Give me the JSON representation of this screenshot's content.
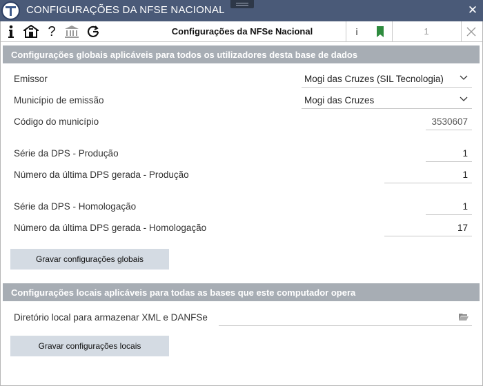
{
  "window": {
    "title": "CONFIGURAÇÕES DA NFSE NACIONAL",
    "close_glyph": "✕"
  },
  "toolbar": {
    "title": "Configurações da NFSe Nacional",
    "info_glyph": "i",
    "help_glyph": "?",
    "count": "1",
    "icons": [
      "info-icon",
      "building-icon",
      "help-icon",
      "bank-icon",
      "refresh-icon",
      "info-small-icon",
      "bookmark-icon",
      "close-icon"
    ],
    "bookmark_color": "#2e8b3e"
  },
  "global_section": {
    "header": "Configurações globais aplicáveis para todos os utilizadores desta base de dados",
    "emissor_label": "Emissor",
    "emissor_value": "Mogi das Cruzes (SIL Tecnologia)",
    "municipio_label": "Município de emissão",
    "municipio_value": "Mogi das Cruzes",
    "codigo_label": "Código do município",
    "codigo_value": "3530607",
    "serie_prod_label": "Série da DPS - Produção",
    "serie_prod_value": "1",
    "numero_prod_label": "Número da última DPS gerada - Produção",
    "numero_prod_value": "1",
    "serie_hom_label": "Série da DPS - Homologação",
    "serie_hom_value": "1",
    "numero_hom_label": "Número da última DPS gerada - Homologação",
    "numero_hom_value": "17",
    "save_button": "Gravar configurações globais"
  },
  "local_section": {
    "header": "Configurações locais aplicáveis para todas as bases que este computador opera",
    "dir_label": "Diretório local para armazenar XML e DANFSe",
    "dir_value": "",
    "save_button": "Gravar configurações locais"
  },
  "colors": {
    "titlebar": "#4a5a78",
    "section_header": "#a7adb4",
    "button": "#d4dbe3"
  }
}
